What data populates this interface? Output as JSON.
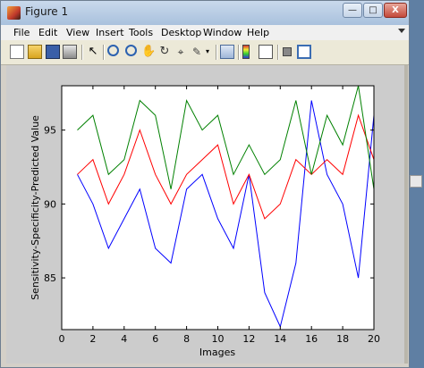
{
  "window": {
    "title": "Figure 1",
    "minimize_label": "—",
    "maximize_label": "□",
    "close_label": "X"
  },
  "menu": {
    "items": [
      "File",
      "Edit",
      "View",
      "Insert",
      "Tools",
      "Desktop",
      "Window",
      "Help"
    ]
  },
  "toolbar": {
    "icons": [
      "new-figure-icon",
      "open-file-icon",
      "save-icon",
      "print-icon",
      "edit-plot-arrow-icon",
      "zoom-in-icon",
      "zoom-out-icon",
      "pan-hand-icon",
      "rotate-3d-icon",
      "data-cursor-icon",
      "brush-icon",
      "brush-dropdown-icon",
      "link-plot-icon",
      "insert-colorbar-icon",
      "insert-legend-icon",
      "hide-plot-tools-icon",
      "show-plot-tools-icon"
    ]
  },
  "colors": {
    "series": [
      "#0000ff",
      "#ff0000",
      "#008000"
    ],
    "axes_bg": "#ffffff",
    "figure_bg": "#cccccc"
  },
  "chart_data": {
    "type": "line",
    "xlabel": "Images",
    "ylabel": "Sensitivity-Specificity-Predicted Value",
    "xlim": [
      0,
      20
    ],
    "ylim": [
      81.5,
      98
    ],
    "xticks": [
      0,
      2,
      4,
      6,
      8,
      10,
      12,
      14,
      16,
      18,
      20
    ],
    "yticks": [
      85,
      90,
      95
    ],
    "grid": false,
    "x": [
      1,
      2,
      3,
      4,
      5,
      6,
      7,
      8,
      9,
      10,
      11,
      12,
      13,
      14,
      15,
      16,
      17,
      18,
      19,
      20
    ],
    "series": [
      {
        "color": "#0000ff",
        "values": [
          92,
          90,
          87,
          89,
          91,
          87,
          86,
          91,
          92,
          89,
          87,
          92,
          84,
          81.7,
          86,
          97,
          92,
          90,
          85,
          96
        ]
      },
      {
        "color": "#ff0000",
        "values": [
          92,
          93,
          90,
          92,
          95,
          92,
          90,
          92,
          93,
          94,
          90,
          92,
          89,
          90,
          93,
          92,
          93,
          92,
          96,
          93
        ]
      },
      {
        "color": "#008000",
        "values": [
          95,
          96,
          92,
          93,
          97,
          96,
          91,
          97,
          95,
          96,
          92,
          94,
          92,
          93,
          97,
          92,
          96,
          94,
          98,
          91
        ]
      }
    ]
  }
}
